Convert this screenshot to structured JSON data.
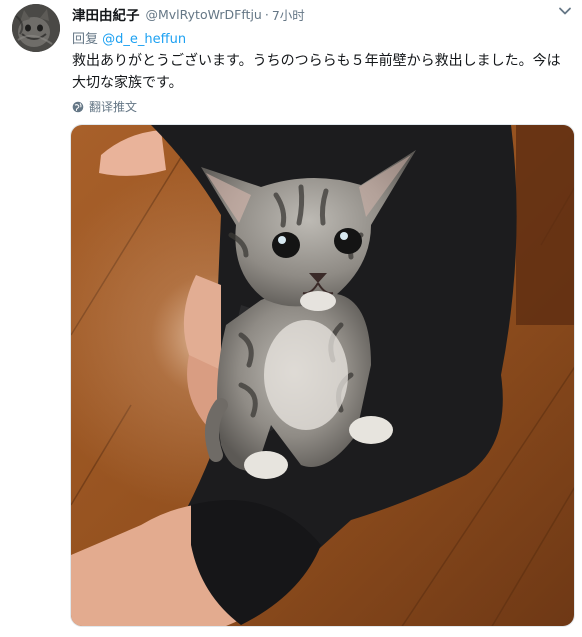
{
  "tweet": {
    "author_name": "津田由紀子",
    "author_handle": "@MvlRytoWrDFftju",
    "separator": "·",
    "time": "7小时",
    "reply_prefix": "回复",
    "reply_to": "@d_e_heffun",
    "text": "救出ありがとうございます。うちのつららも５年前壁から救出しました。今は大切な家族です。",
    "translate_label": "翻译推文"
  },
  "icons": {
    "avatar": "avatar-cat",
    "menu": "chevron-down-icon",
    "translate": "globe-icon"
  },
  "colors": {
    "link": "#1da1f2",
    "meta": "#657786",
    "text": "#14171a"
  }
}
